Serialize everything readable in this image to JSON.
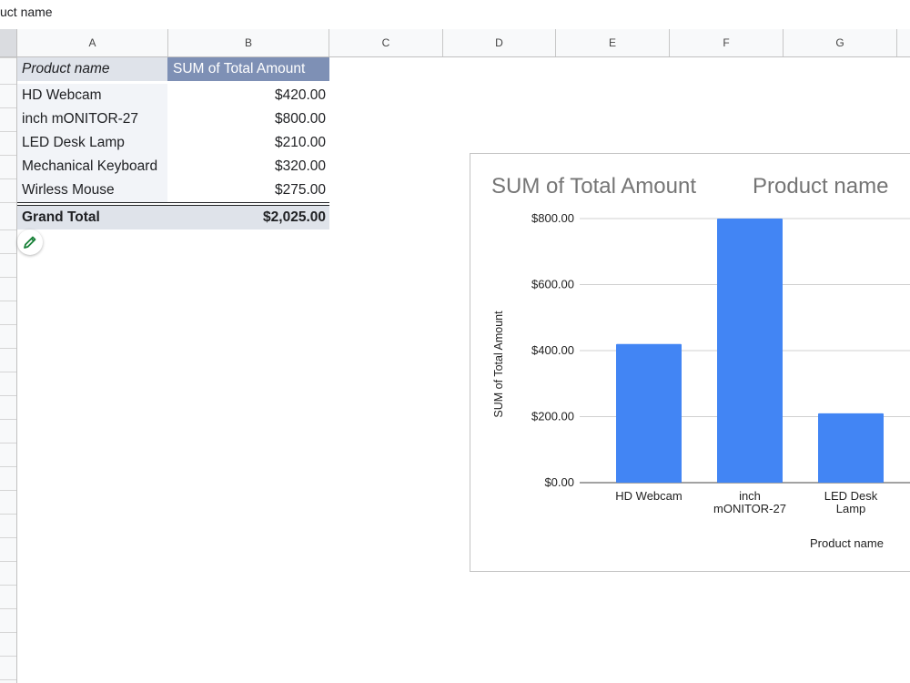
{
  "formula_bar": {
    "content": "uct name"
  },
  "columns": [
    "A",
    "B",
    "C",
    "D",
    "E",
    "F",
    "G"
  ],
  "pivot": {
    "header": {
      "col_a": "Product name",
      "col_b": "SUM of Total Amount"
    },
    "rows": [
      {
        "name": "HD Webcam",
        "amount": "$420.00"
      },
      {
        "name": "inch mONITOR-27",
        "amount": "$800.00"
      },
      {
        "name": "LED Desk Lamp",
        "amount": "$210.00"
      },
      {
        "name": "Mechanical Keyboard",
        "amount": "$320.00"
      },
      {
        "name": "Wirless Mouse",
        "amount": "$275.00"
      }
    ],
    "grand_total": {
      "label": "Grand Total",
      "amount": "$2,025.00"
    }
  },
  "edit_icon": "pencil-icon",
  "colors": {
    "bar": "#4285f4",
    "pivot_header": "#7e90b5",
    "selection": "#1a73e8",
    "edit_icon": "#188038"
  },
  "chart_data": {
    "type": "bar",
    "title_left": "SUM of Total Amount",
    "title_right": "Product name",
    "xlabel": "Product name",
    "ylabel": "SUM of Total Amount",
    "ylim": [
      0,
      800
    ],
    "yticks": [
      "$0.00",
      "$200.00",
      "$400.00",
      "$600.00",
      "$800.00"
    ],
    "categories": [
      "HD Webcam",
      "inch mONITOR-27",
      "LED Desk Lamp"
    ],
    "category_lines": [
      [
        "HD Webcam"
      ],
      [
        "inch",
        "mONITOR-27"
      ],
      [
        "LED Desk",
        "Lamp"
      ]
    ],
    "values": [
      420,
      800,
      210
    ],
    "grid": true
  }
}
